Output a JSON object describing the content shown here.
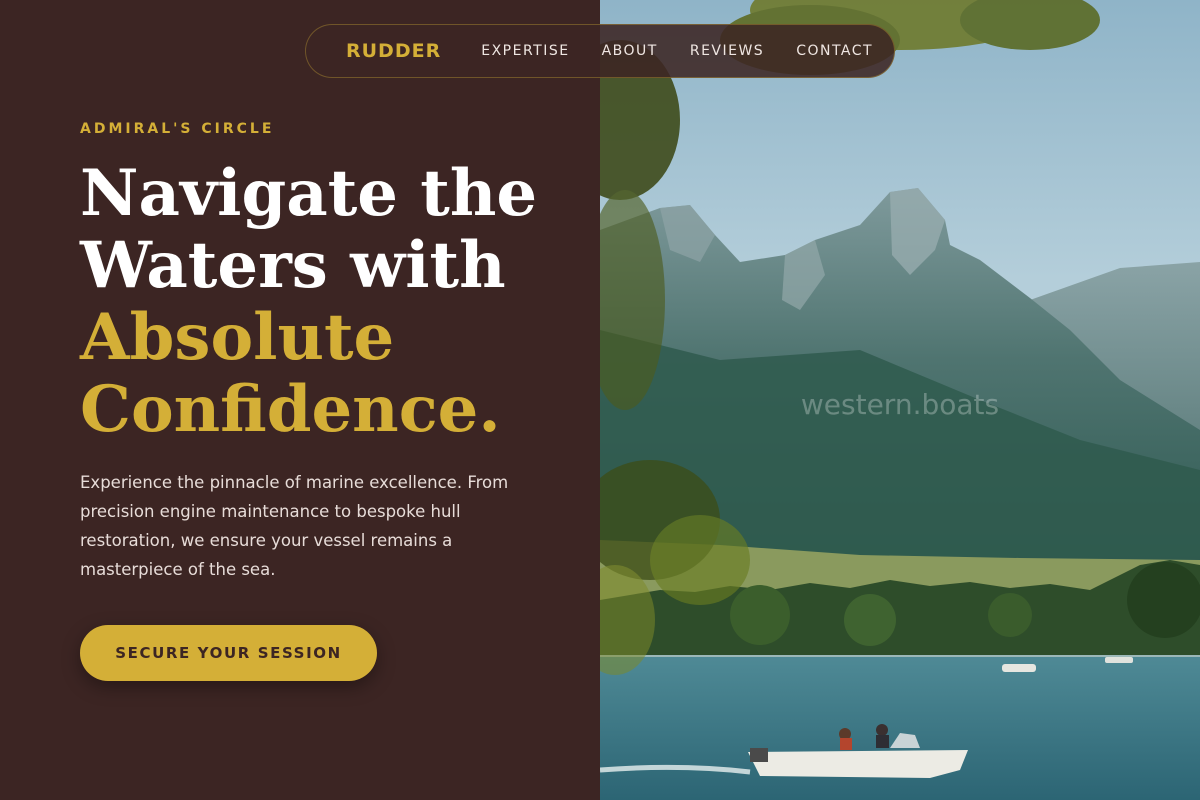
{
  "nav": {
    "brand": "RUDDER",
    "links": [
      {
        "label": "EXPERTISE"
      },
      {
        "label": "ABOUT"
      },
      {
        "label": "REVIEWS"
      },
      {
        "label": "CONTACT"
      }
    ]
  },
  "hero": {
    "eyebrow": "ADMIRAL'S CIRCLE",
    "headline_white": [
      "Navigate the",
      "Waters with"
    ],
    "headline_gold": [
      "Absolute",
      "Confidence."
    ],
    "description": "Experience the pinnacle of marine excellence. From precision engine maintenance to bespoke hull restoration, we ensure your vessel remains a masterpiece of the sea.",
    "cta_label": "SECURE YOUR SESSION"
  },
  "photo": {
    "watermark": "western.boats"
  },
  "colors": {
    "background": "#3c2523",
    "accent_gold": "#d4af37",
    "text_light": "#e7dcd8"
  }
}
